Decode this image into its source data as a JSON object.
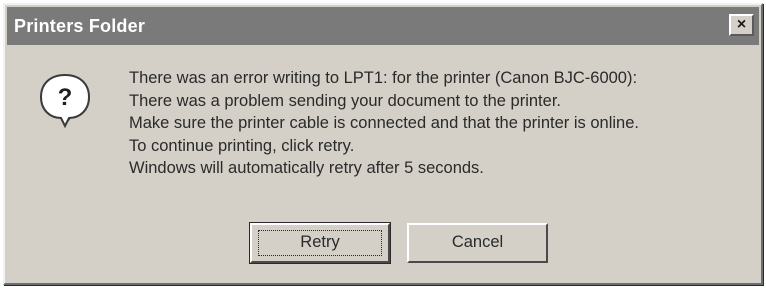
{
  "window": {
    "title": "Printers Folder",
    "close_label": "×"
  },
  "icon": {
    "name": "question-icon",
    "glyph": "?"
  },
  "message": {
    "lines": [
      "There was an error writing to LPT1: for the printer (Canon BJC-6000):",
      "There was a problem sending your document to the printer.",
      "Make sure the printer cable is connected and that the printer is online.",
      "To continue printing, click retry.",
      "Windows will automatically retry after 5 seconds."
    ]
  },
  "buttons": {
    "retry_label": "Retry",
    "cancel_label": "Cancel"
  },
  "colors": {
    "face": "#d4d0c8",
    "titlebar": "#7a7a7a",
    "title_text": "#ffffff"
  }
}
